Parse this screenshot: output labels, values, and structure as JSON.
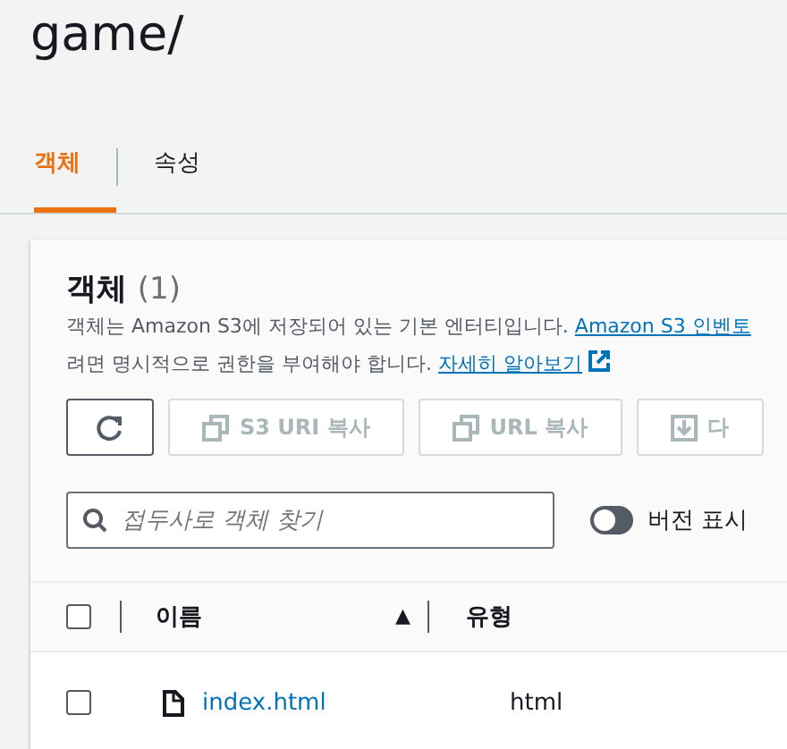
{
  "page_title": "game/",
  "tabs": [
    {
      "label": "객체",
      "selected": true
    },
    {
      "label": "속성",
      "selected": false
    }
  ],
  "panel": {
    "heading": "객체",
    "count": "(1)",
    "description": [
      {
        "text": "객체는 Amazon S3에 저장되어 있는 기본 엔터티입니다. ",
        "link": "Amazon S3 인벤토",
        "external": false
      },
      {
        "text": "려면 명시적으로 권한을 부여해야 합니다. ",
        "link": "자세히 알아보기",
        "external": true
      }
    ],
    "actions": [
      {
        "kind": "refresh",
        "disabled": false
      },
      {
        "kind": "copy",
        "label": "S3 URI 복사",
        "disabled": true
      },
      {
        "kind": "copy",
        "label": "URL 복사",
        "disabled": true
      },
      {
        "kind": "download",
        "label": "다",
        "disabled": true
      }
    ],
    "search": {
      "placeholder": "접두사로 객체 찾기"
    },
    "versions_toggle": {
      "label": "버전 표시",
      "on": false
    },
    "table": {
      "select_all_checked": false,
      "columns": [
        {
          "label": "이름",
          "sort": "▲"
        },
        {
          "label": "유형"
        }
      ],
      "rows": [
        {
          "name": "index.html",
          "type": "html",
          "checked": false
        }
      ]
    }
  }
}
